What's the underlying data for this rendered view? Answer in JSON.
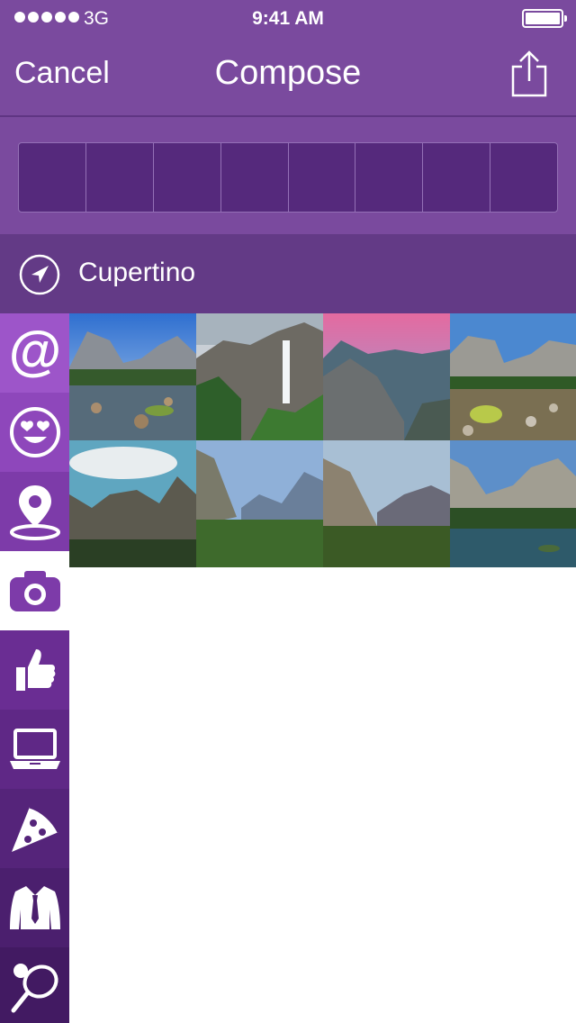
{
  "status_bar": {
    "carrier": "3G",
    "time": "9:41 AM"
  },
  "nav": {
    "cancel_label": "Cancel",
    "title": "Compose",
    "share_icon": "share-icon"
  },
  "composer": {
    "slot_count": 8
  },
  "location": {
    "label": "Cupertino",
    "icon": "location-arrow-icon"
  },
  "categories": [
    {
      "name": "mention",
      "icon": "at-icon",
      "selected": false
    },
    {
      "name": "emoji",
      "icon": "heart-eyes-icon",
      "selected": false
    },
    {
      "name": "places",
      "icon": "map-pin-icon",
      "selected": false
    },
    {
      "name": "photos",
      "icon": "camera-icon",
      "selected": true
    },
    {
      "name": "likes",
      "icon": "thumbs-up-icon",
      "selected": false
    },
    {
      "name": "tech",
      "icon": "laptop-icon",
      "selected": false
    },
    {
      "name": "food",
      "icon": "pizza-icon",
      "selected": false
    },
    {
      "name": "fashion",
      "icon": "suit-icon",
      "selected": false
    },
    {
      "name": "sports",
      "icon": "racket-icon",
      "selected": false
    }
  ],
  "photos": [
    {
      "subject": "valley-river"
    },
    {
      "subject": "waterfall"
    },
    {
      "subject": "sunset-valley"
    },
    {
      "subject": "meadow-cliff"
    },
    {
      "subject": "tunnel-view"
    },
    {
      "subject": "forest-valley"
    },
    {
      "subject": "el-capitan"
    },
    {
      "subject": "river-reflection"
    }
  ],
  "colors": {
    "header": "#7a4a9e",
    "slots": "#55297c",
    "location_bar": "#633a86",
    "category_tones": [
      "#9d55c9",
      "#8e47bb",
      "#7d3ba9",
      "#ffffff",
      "#6a2d93",
      "#5f2886",
      "#55247a",
      "#4b1f6e",
      "#421a62"
    ],
    "selected_icon": "#7d3ba9"
  }
}
